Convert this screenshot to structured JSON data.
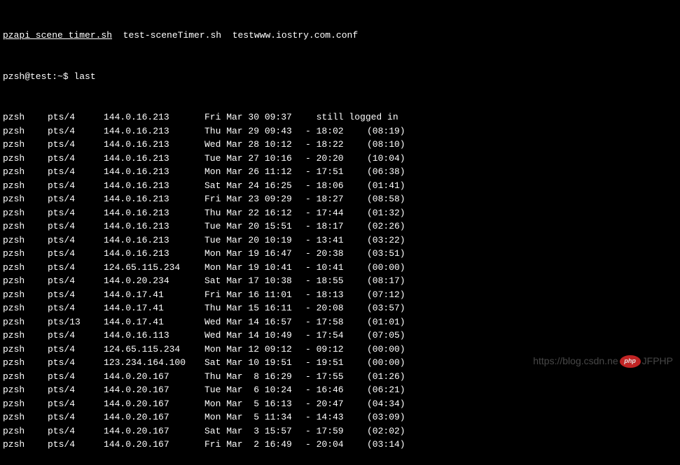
{
  "header": {
    "file1": "pzapi_scene_timer.sh",
    "file2": "test-sceneTimer.sh",
    "file3": "testwww.iostry.com.conf"
  },
  "prompt": {
    "text": "pzsh@test:~$ last"
  },
  "rows": [
    {
      "user": "pzsh",
      "tty": "pts/4",
      "ip": "144.0.16.213",
      "date": "Fri Mar 30 09:37",
      "still": "  still logged in"
    },
    {
      "user": "pzsh",
      "tty": "pts/4",
      "ip": "144.0.16.213",
      "date": "Thu Mar 29 09:43",
      "logout": "- 18:02",
      "duration": "(08:19)"
    },
    {
      "user": "pzsh",
      "tty": "pts/4",
      "ip": "144.0.16.213",
      "date": "Wed Mar 28 10:12",
      "logout": "- 18:22",
      "duration": "(08:10)"
    },
    {
      "user": "pzsh",
      "tty": "pts/4",
      "ip": "144.0.16.213",
      "date": "Tue Mar 27 10:16",
      "logout": "- 20:20",
      "duration": "(10:04)"
    },
    {
      "user": "pzsh",
      "tty": "pts/4",
      "ip": "144.0.16.213",
      "date": "Mon Mar 26 11:12",
      "logout": "- 17:51",
      "duration": "(06:38)"
    },
    {
      "user": "pzsh",
      "tty": "pts/4",
      "ip": "144.0.16.213",
      "date": "Sat Mar 24 16:25",
      "logout": "- 18:06",
      "duration": "(01:41)"
    },
    {
      "user": "pzsh",
      "tty": "pts/4",
      "ip": "144.0.16.213",
      "date": "Fri Mar 23 09:29",
      "logout": "- 18:27",
      "duration": "(08:58)"
    },
    {
      "user": "pzsh",
      "tty": "pts/4",
      "ip": "144.0.16.213",
      "date": "Thu Mar 22 16:12",
      "logout": "- 17:44",
      "duration": "(01:32)"
    },
    {
      "user": "pzsh",
      "tty": "pts/4",
      "ip": "144.0.16.213",
      "date": "Tue Mar 20 15:51",
      "logout": "- 18:17",
      "duration": "(02:26)"
    },
    {
      "user": "pzsh",
      "tty": "pts/4",
      "ip": "144.0.16.213",
      "date": "Tue Mar 20 10:19",
      "logout": "- 13:41",
      "duration": "(03:22)"
    },
    {
      "user": "pzsh",
      "tty": "pts/4",
      "ip": "144.0.16.213",
      "date": "Mon Mar 19 16:47",
      "logout": "- 20:38",
      "duration": "(03:51)"
    },
    {
      "user": "pzsh",
      "tty": "pts/4",
      "ip": "124.65.115.234",
      "date": "Mon Mar 19 10:41",
      "logout": "- 10:41",
      "duration": "(00:00)"
    },
    {
      "user": "pzsh",
      "tty": "pts/4",
      "ip": "144.0.20.234",
      "date": "Sat Mar 17 10:38",
      "logout": "- 18:55",
      "duration": "(08:17)"
    },
    {
      "user": "pzsh",
      "tty": "pts/4",
      "ip": "144.0.17.41",
      "date": "Fri Mar 16 11:01",
      "logout": "- 18:13",
      "duration": "(07:12)"
    },
    {
      "user": "pzsh",
      "tty": "pts/4",
      "ip": "144.0.17.41",
      "date": "Thu Mar 15 16:11",
      "logout": "- 20:08",
      "duration": "(03:57)"
    },
    {
      "user": "pzsh",
      "tty": "pts/13",
      "ip": "144.0.17.41",
      "date": "Wed Mar 14 16:57",
      "logout": "- 17:58",
      "duration": "(01:01)"
    },
    {
      "user": "pzsh",
      "tty": "pts/4",
      "ip": "144.0.16.113",
      "date": "Wed Mar 14 10:49",
      "logout": "- 17:54",
      "duration": "(07:05)"
    },
    {
      "user": "pzsh",
      "tty": "pts/4",
      "ip": "124.65.115.234",
      "date": "Mon Mar 12 09:12",
      "logout": "- 09:12",
      "duration": "(00:00)"
    },
    {
      "user": "pzsh",
      "tty": "pts/4",
      "ip": "123.234.164.100",
      "date": "Sat Mar 10 19:51",
      "logout": "- 19:51",
      "duration": "(00:00)"
    },
    {
      "user": "pzsh",
      "tty": "pts/4",
      "ip": "144.0.20.167",
      "date": "Thu Mar  8 16:29",
      "logout": "- 17:55",
      "duration": "(01:26)"
    },
    {
      "user": "pzsh",
      "tty": "pts/4",
      "ip": "144.0.20.167",
      "date": "Tue Mar  6 10:24",
      "logout": "- 16:46",
      "duration": "(06:21)"
    },
    {
      "user": "pzsh",
      "tty": "pts/4",
      "ip": "144.0.20.167",
      "date": "Mon Mar  5 16:13",
      "logout": "- 20:47",
      "duration": "(04:34)"
    },
    {
      "user": "pzsh",
      "tty": "pts/4",
      "ip": "144.0.20.167",
      "date": "Mon Mar  5 11:34",
      "logout": "- 14:43",
      "duration": "(03:09)"
    },
    {
      "user": "pzsh",
      "tty": "pts/4",
      "ip": "144.0.20.167",
      "date": "Sat Mar  3 15:57",
      "logout": "- 17:59",
      "duration": "(02:02)"
    },
    {
      "user": "pzsh",
      "tty": "pts/4",
      "ip": "144.0.20.167",
      "date": "Fri Mar  2 16:49",
      "logout": "- 20:04",
      "duration": "(03:14)"
    }
  ],
  "watermark": {
    "prefix": "https://blog.csdn.ne",
    "badge": "php",
    "suffix": "JFPHP"
  }
}
